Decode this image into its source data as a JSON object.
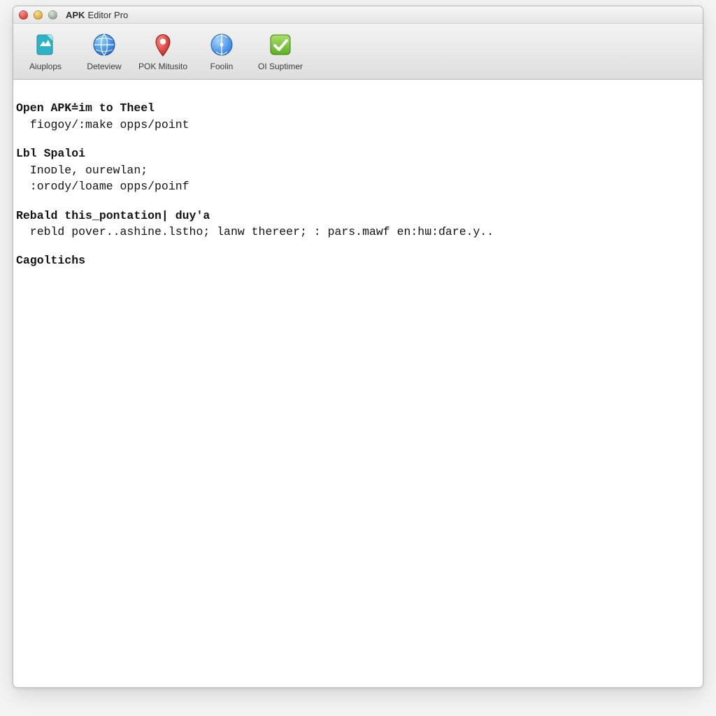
{
  "window": {
    "title_bold": "APK",
    "title_rest": "Editor Pro"
  },
  "toolbar": {
    "items": [
      {
        "label": "Aiuplops",
        "icon": "file-teal-icon"
      },
      {
        "label": "Deteview",
        "icon": "globe-blue-icon"
      },
      {
        "label": "POK Mitusito",
        "icon": "pin-red-icon"
      },
      {
        "label": "Foolin",
        "icon": "disc-blue-icon"
      },
      {
        "label": "OI Suptimer",
        "icon": "check-green-icon"
      }
    ]
  },
  "content": {
    "sections": [
      {
        "header": "Open APK≐im to Theel",
        "lines": [
          "  fiogoy/:make opps/point"
        ]
      },
      {
        "header": "Lbl Spaloi",
        "lines": [
          "  Inoᴅle, ourewlan;",
          "  :orody/loame opps/poinf"
        ]
      },
      {
        "header": "Rebald this_pontation| duy'a",
        "lines": [
          "  rebld pover..ashine.lstho; lanw thereer; : pars.mawf en:hɯ:ɗare.y.."
        ]
      },
      {
        "header": "Cagoltichs",
        "lines": []
      }
    ]
  }
}
